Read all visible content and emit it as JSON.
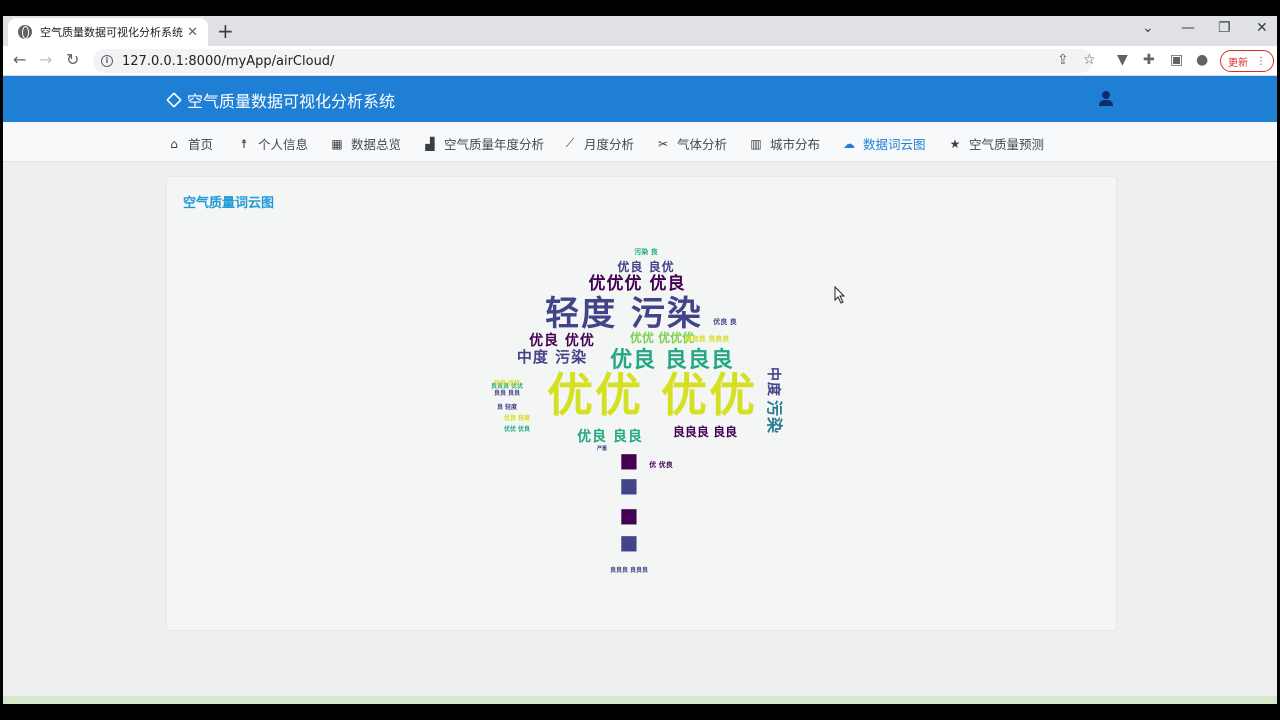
{
  "browser": {
    "tab_title": "空气质量数据可视化分析系统",
    "tab_close": "✕",
    "new_tab": "+",
    "url": "127.0.0.1:8000/myApp/airCloud/",
    "update_label": "更新"
  },
  "app": {
    "title": "空气质量数据可视化分析系统"
  },
  "nav": {
    "items": [
      {
        "label": "首页",
        "icon": "home-icon"
      },
      {
        "label": "个人信息",
        "icon": "person-icon"
      },
      {
        "label": "数据总览",
        "icon": "table-icon"
      },
      {
        "label": "空气质量年度分析",
        "icon": "bar-chart-icon"
      },
      {
        "label": "月度分析",
        "icon": "line-chart-icon"
      },
      {
        "label": "气体分析",
        "icon": "gas-icon"
      },
      {
        "label": "城市分布",
        "icon": "map-icon"
      },
      {
        "label": "数据词云图",
        "icon": "cloud-icon"
      },
      {
        "label": "空气质量预测",
        "icon": "star-icon"
      }
    ],
    "active_index": 7
  },
  "card": {
    "title": "空气质量词云图"
  },
  "wordcloud": {
    "palette": [
      "#d4e021",
      "#22a884",
      "#2a788e",
      "#414487",
      "#440154",
      "#7ad151"
    ],
    "words": [
      {
        "text": "污染 良"
      },
      {
        "text": "优良 良优"
      },
      {
        "text": "优优优 优良"
      },
      {
        "text": "轻度 污染"
      },
      {
        "text": "优良 良"
      },
      {
        "text": "优良 优优"
      },
      {
        "text": "优优 优优优"
      },
      {
        "text": "良良良 良良良"
      },
      {
        "text": "中度 污染"
      },
      {
        "text": "优良 良良良"
      },
      {
        "text": "优优 优优"
      },
      {
        "text": "优良 良良"
      },
      {
        "text": "良良良 良良"
      },
      {
        "text": "良良良 优优"
      },
      {
        "text": "优良 优优"
      },
      {
        "text": "良 轻度"
      },
      {
        "text": "优良 轻度"
      },
      {
        "text": "优优 优良"
      },
      {
        "text": "良良 良良"
      },
      {
        "text": "中度"
      },
      {
        "text": "污染"
      },
      {
        "text": "严重"
      },
      {
        "text": "优 优良"
      },
      {
        "text": "良良良 良良良"
      }
    ]
  }
}
